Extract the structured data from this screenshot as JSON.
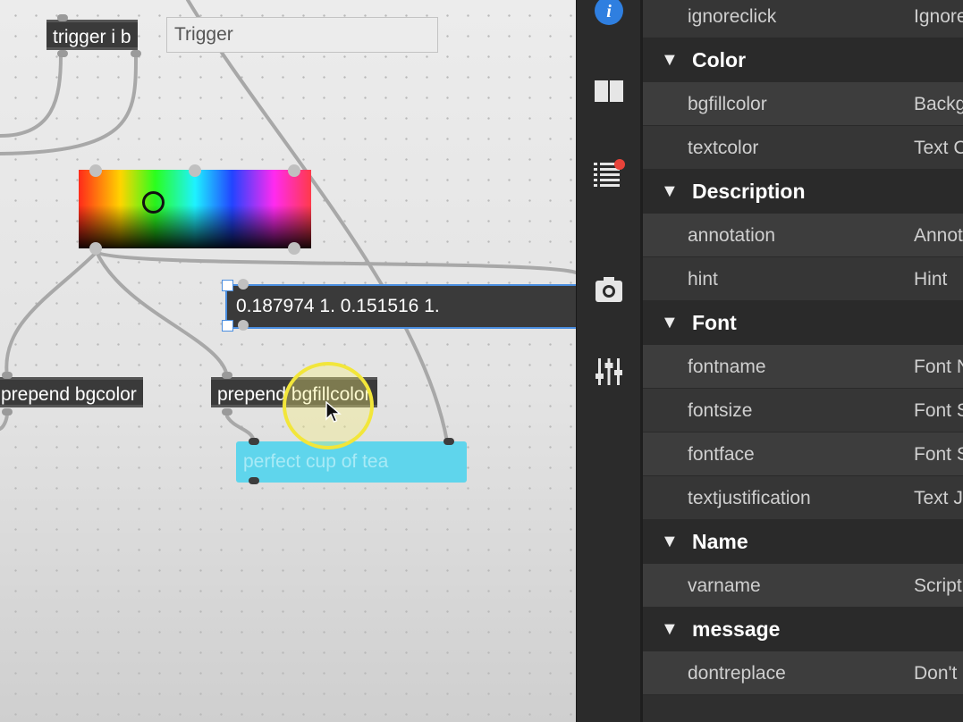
{
  "patcher": {
    "trigger_label": "trigger i b",
    "trigger_comment": "Trigger",
    "message_value": "0.187974 1. 0.151516 1.",
    "prepend_bgcolor": "prepend bgcolor",
    "prepend_bgfillcolor": "prepend bgfillcolor",
    "textbutton_text": "perfect cup of tea"
  },
  "sidebar": {
    "icons": [
      "info-icon",
      "book-icon",
      "list-icon",
      "camera-icon",
      "mixer-icon"
    ],
    "notification_color": "#e8433a",
    "info_color": "#2f7fe0"
  },
  "inspector": {
    "rows": [
      {
        "type": "attr",
        "name": "ignoreclick",
        "label": "Ignore"
      },
      {
        "type": "cat",
        "name": "Color"
      },
      {
        "type": "attr",
        "name": "bgfillcolor",
        "label": "Backg"
      },
      {
        "type": "attr",
        "name": "textcolor",
        "label": "Text C"
      },
      {
        "type": "cat",
        "name": "Description"
      },
      {
        "type": "attr",
        "name": "annotation",
        "label": "Annot"
      },
      {
        "type": "attr",
        "name": "hint",
        "label": "Hint"
      },
      {
        "type": "cat",
        "name": "Font"
      },
      {
        "type": "attr",
        "name": "fontname",
        "label": "Font N"
      },
      {
        "type": "attr",
        "name": "fontsize",
        "label": "Font S"
      },
      {
        "type": "attr",
        "name": "fontface",
        "label": "Font S"
      },
      {
        "type": "attr",
        "name": "textjustification",
        "label": "Text J"
      },
      {
        "type": "cat",
        "name": "Name"
      },
      {
        "type": "attr",
        "name": "varname",
        "label": "Script"
      },
      {
        "type": "cat",
        "name": "message"
      },
      {
        "type": "attr",
        "name": "dontreplace",
        "label": "Don't"
      }
    ],
    "collapse_glyph": "▼"
  }
}
